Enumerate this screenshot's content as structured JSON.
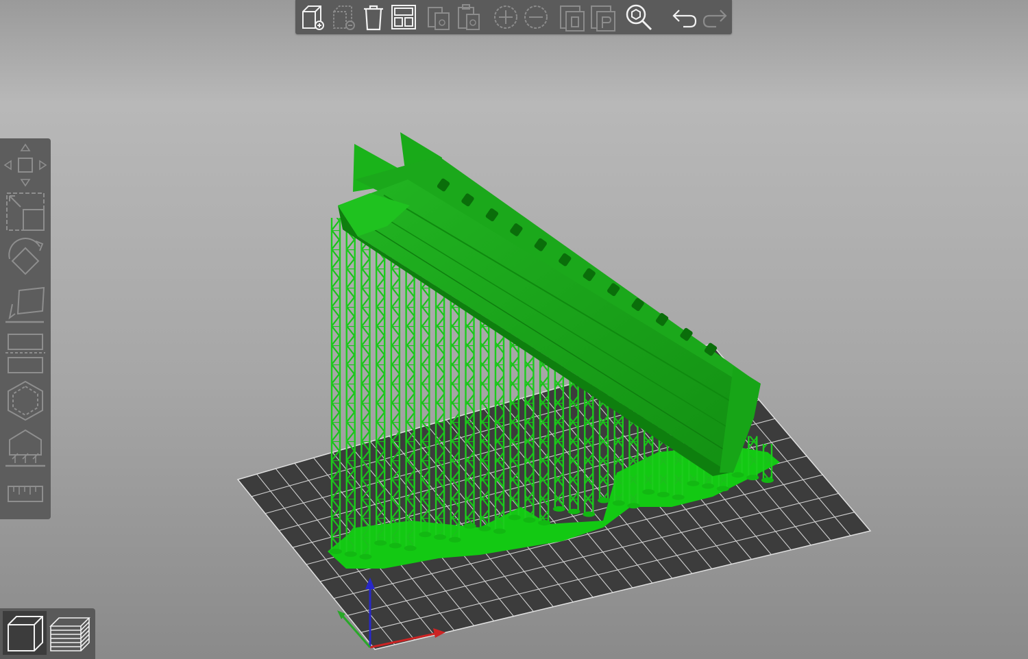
{
  "app": {
    "view": "3D",
    "accent_color": "#ffffff",
    "model_color": "#18c018",
    "bed_color": "#3c3c3c",
    "grid_color": "#d8d8d8"
  },
  "toolbar": {
    "items": [
      {
        "icon": "add-object-icon",
        "enabled": true
      },
      {
        "icon": "delete-object-icon",
        "enabled": false
      },
      {
        "icon": "delete-all-icon",
        "enabled": true
      },
      {
        "icon": "arrange-icon",
        "enabled": true
      },
      {
        "icon": "copy-icon",
        "enabled": false
      },
      {
        "icon": "paste-icon",
        "enabled": false
      },
      {
        "icon": "add-instance-icon",
        "enabled": false
      },
      {
        "icon": "remove-instance-icon",
        "enabled": false
      },
      {
        "icon": "split-to-objects-icon",
        "enabled": false
      },
      {
        "icon": "split-to-parts-icon",
        "enabled": false
      },
      {
        "icon": "search-icon",
        "enabled": true
      },
      {
        "icon": "undo-icon",
        "enabled": true
      },
      {
        "icon": "redo-icon",
        "enabled": false
      }
    ]
  },
  "sidebar": {
    "items": [
      {
        "icon": "move-icon"
      },
      {
        "icon": "scale-icon"
      },
      {
        "icon": "rotate-icon"
      },
      {
        "icon": "place-on-face-icon"
      },
      {
        "icon": "cut-icon"
      },
      {
        "icon": "hollow-icon"
      },
      {
        "icon": "sla-support-points-icon"
      },
      {
        "icon": "measure-icon"
      }
    ]
  },
  "view_mode": {
    "items": [
      {
        "icon": "3d-view-icon",
        "active": true
      },
      {
        "icon": "layer-preview-icon",
        "active": false
      }
    ]
  },
  "axes": {
    "x_color": "#cc2020",
    "y_color": "#20a020",
    "z_color": "#2020c0"
  }
}
